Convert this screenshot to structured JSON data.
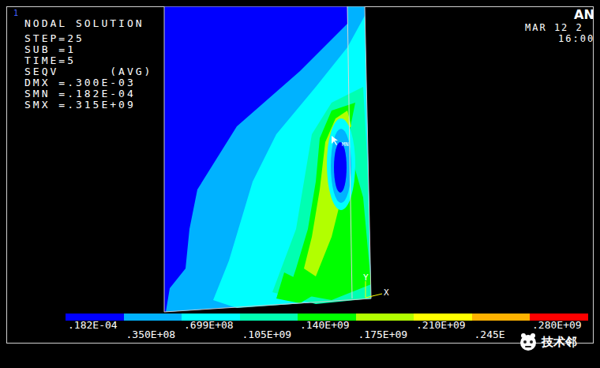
{
  "viewport": {
    "number": "1"
  },
  "info": {
    "title": "NODAL SOLUTION",
    "lines": [
      "STEP=25",
      "SUB =1",
      "TIME=5",
      "SEQV      (AVG)",
      "DMX =.300E-03",
      "SMN =.182E-04",
      "SMX =.315E+09"
    ]
  },
  "logo": "AN",
  "date": "MAR 12 2",
  "time": "16:00",
  "markers": {
    "min": "MN"
  },
  "axes": {
    "y": "Y",
    "x": "X"
  },
  "legend": [
    {
      "label": ".182E-04",
      "color": "#0000ff"
    },
    {
      "label": ".350E+08",
      "color": "#00b2ff"
    },
    {
      "label": ".699E+08",
      "color": "#00ffff"
    },
    {
      "label": ".105E+09",
      "color": "#00ffb2"
    },
    {
      "label": ".140E+09",
      "color": "#00ff00"
    },
    {
      "label": ".175E+09",
      "color": "#b2ff00"
    },
    {
      "label": ".210E+09",
      "color": "#ffff00"
    },
    {
      "label": ".245E",
      "color": "#ffb200"
    },
    {
      "label": ".280E+09",
      "color": "#ff0000"
    }
  ],
  "watermark": "技术邻"
}
